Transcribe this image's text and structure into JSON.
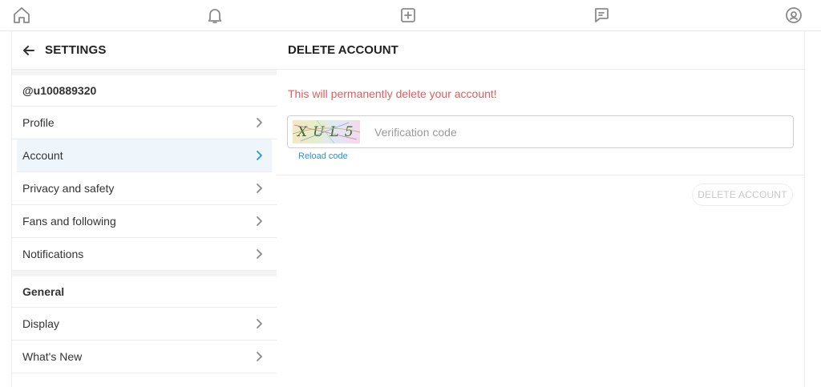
{
  "nav": {
    "icons": [
      "home-icon",
      "bell-icon",
      "plus-square-icon",
      "chat-icon",
      "user-circle-icon"
    ]
  },
  "sidebar": {
    "title": "SETTINGS",
    "username": "@u100889320",
    "account_items": [
      {
        "label": "Profile"
      },
      {
        "label": "Account",
        "active": true
      },
      {
        "label": "Privacy and safety"
      },
      {
        "label": "Fans and following"
      },
      {
        "label": "Notifications"
      }
    ],
    "general_heading": "General",
    "general_items": [
      {
        "label": "Display"
      },
      {
        "label": "What's New"
      }
    ]
  },
  "main": {
    "title": "DELETE ACCOUNT",
    "warning": "This will permanently delete your account!",
    "captcha_text": "XUL5",
    "code_placeholder": "Verification code",
    "code_value": "",
    "reload_label": "Reload code",
    "delete_button_label": "DELETE ACCOUNT"
  },
  "colors": {
    "accent": "#1e9bd8",
    "warning": "#e25c5c",
    "active_bg": "#eef6fb",
    "disabled_text": "#c8c8c8"
  }
}
